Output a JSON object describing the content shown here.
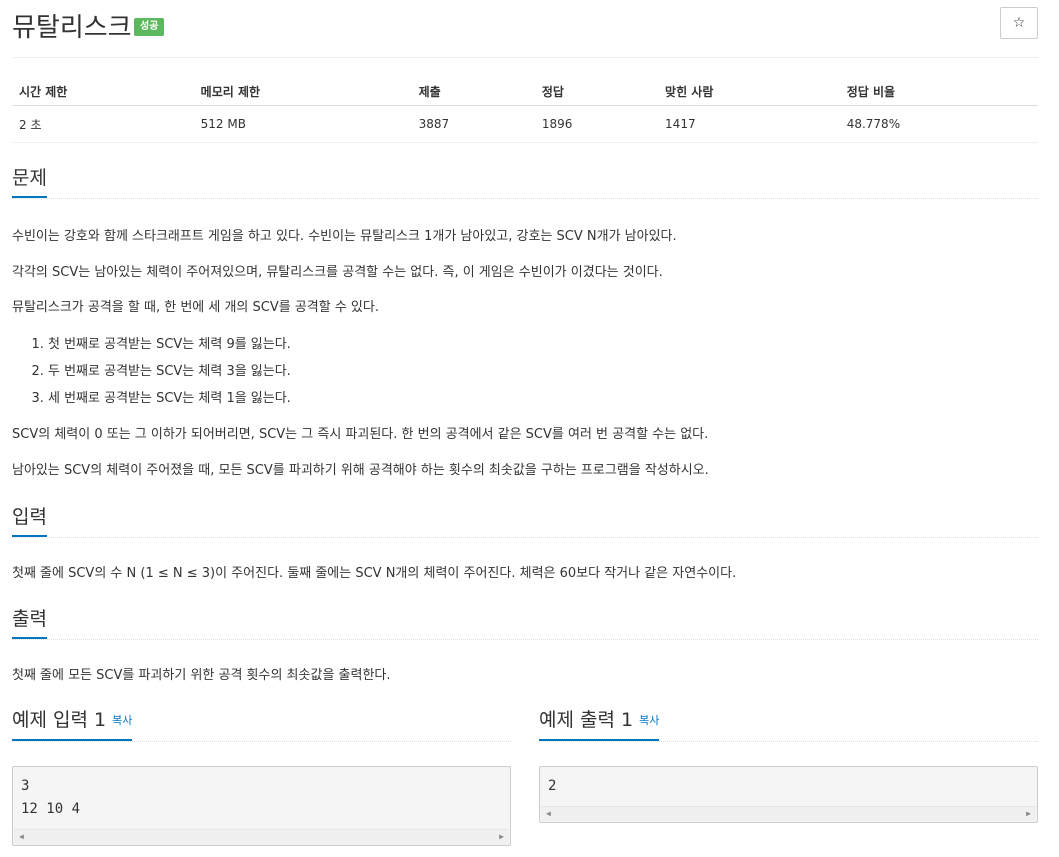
{
  "problem": {
    "title": "뮤탈리스크",
    "status_badge": "성공",
    "star_label": "☆"
  },
  "info_table": {
    "headers": [
      "시간 제한",
      "메모리 제한",
      "제출",
      "정답",
      "맞힌 사람",
      "정답 비율"
    ],
    "values": [
      "2 초",
      "512 MB",
      "3887",
      "1896",
      "1417",
      "48.778%"
    ]
  },
  "description": {
    "heading": "문제",
    "paragraphs": [
      "수빈이는 강호와 함께 스타크래프트 게임을 하고 있다. 수빈이는 뮤탈리스크 1개가 남아있고, 강호는 SCV N개가 남아있다.",
      "각각의 SCV는 남아있는 체력이 주어져있으며, 뮤탈리스크를 공격할 수는 없다. 즉, 이 게임은 수빈이가 이겼다는 것이다.",
      "뮤탈리스크가 공격을 할 때, 한 번에 세 개의 SCV를 공격할 수 있다."
    ],
    "rules": [
      "첫 번째로 공격받는 SCV는 체력 9를 잃는다.",
      "두 번째로 공격받는 SCV는 체력 3을 잃는다.",
      "세 번째로 공격받는 SCV는 체력 1을 잃는다."
    ],
    "paragraphs_after": [
      "SCV의 체력이 0 또는 그 이하가 되어버리면, SCV는 그 즉시 파괴된다. 한 번의 공격에서 같은 SCV를 여러 번 공격할 수는 없다.",
      "남아있는 SCV의 체력이 주어졌을 때, 모든 SCV를 파괴하기 위해 공격해야 하는 횟수의 최솟값을 구하는 프로그램을 작성하시오."
    ]
  },
  "input": {
    "heading": "입력",
    "text": "첫째 줄에 SCV의 수 N (1 ≤ N ≤ 3)이 주어진다. 둘째 줄에는 SCV N개의 체력이 주어진다. 체력은 60보다 작거나 같은 자연수이다."
  },
  "output": {
    "heading": "출력",
    "text": "첫째 줄에 모든 SCV를 파괴하기 위한 공격 횟수의 최솟값을 출력한다."
  },
  "samples": {
    "input_heading": "예제 입력 1",
    "output_heading": "예제 출력 1",
    "copy_label": "복사",
    "input_text": "3\n12 10 4",
    "output_text": "2"
  }
}
